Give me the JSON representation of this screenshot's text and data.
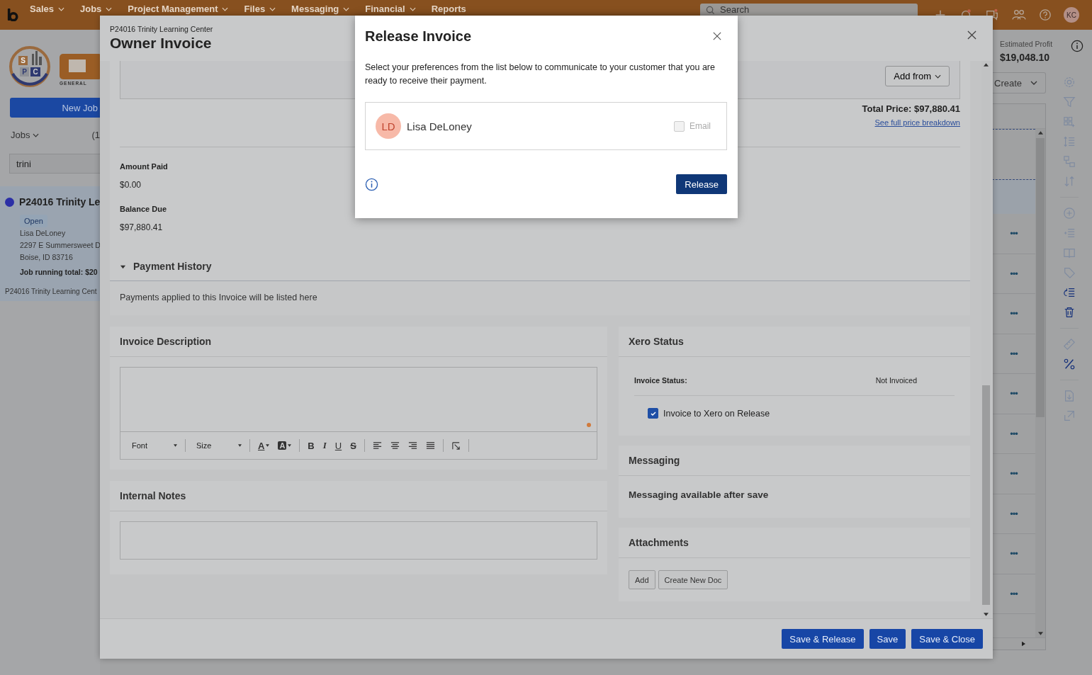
{
  "topbar": {
    "nav": [
      {
        "label": "Sales",
        "dropdown": true
      },
      {
        "label": "Jobs",
        "dropdown": true
      },
      {
        "label": "Project Management",
        "dropdown": true
      },
      {
        "label": "Files",
        "dropdown": true
      },
      {
        "label": "Messaging",
        "dropdown": true
      },
      {
        "label": "Financial",
        "dropdown": true
      },
      {
        "label": "Reports",
        "dropdown": false
      }
    ],
    "search": {
      "placeholder": "Search"
    },
    "avatar": "KC"
  },
  "sidebar": {
    "logo": {
      "letters": [
        "S",
        "P",
        "C"
      ],
      "caption": "GENERAL"
    },
    "new_job": "New Job",
    "jobs_filter": "Jobs",
    "count": "(1",
    "search": {
      "value": "trini"
    },
    "job": {
      "title": "P24016 Trinity Le",
      "color": "#2b2fa6",
      "status": "Open",
      "contact": [
        "Lisa DeLoney",
        "2297 E Summersweet D",
        "Boise, ID 83716"
      ],
      "total": "Job running total: $20",
      "selected": true
    },
    "footer": "P24016 Trinity Learning Cent"
  },
  "job_summary": {
    "profit_label": "Estimated Profit",
    "profit": "$19,048.10",
    "create": "Create",
    "row_menus": [
      "•••",
      "•••",
      "•••",
      "•••",
      "•••",
      "•••",
      "•••",
      "•••",
      "•••",
      "•••"
    ],
    "tools": [
      {
        "kind": "settings",
        "enabled": false
      },
      {
        "kind": "filter",
        "enabled": false
      },
      {
        "kind": "grid",
        "enabled": false
      },
      {
        "kind": "line-height",
        "enabled": false
      },
      {
        "kind": "blocks",
        "enabled": false
      },
      {
        "kind": "sort",
        "enabled": false
      },
      {
        "kind": "separator"
      },
      {
        "kind": "add",
        "enabled": false
      },
      {
        "kind": "list-add",
        "enabled": false
      },
      {
        "kind": "book",
        "enabled": false
      },
      {
        "kind": "tag",
        "enabled": false
      },
      {
        "kind": "list-redo",
        "enabled": true
      },
      {
        "kind": "trash",
        "enabled": true
      },
      {
        "kind": "separator"
      },
      {
        "kind": "ruler",
        "enabled": false
      },
      {
        "kind": "percent",
        "enabled": true
      },
      {
        "kind": "separator"
      },
      {
        "kind": "file",
        "enabled": false
      },
      {
        "kind": "export",
        "enabled": false
      }
    ]
  },
  "invoice": {
    "job": "P24016 Trinity Learning Center",
    "title": "Owner Invoice",
    "add_from": "Add from",
    "total_price": "Total Price: $97,880.41",
    "breakdown_link": "See full price breakdown",
    "amount_paid": {
      "label": "Amount Paid",
      "value": "$0.00"
    },
    "balance_due": {
      "label": "Balance Due",
      "value": "$97,880.41"
    },
    "payment_history": {
      "title": "Payment History",
      "expanded": true,
      "empty_text": "Payments applied to this Invoice will be listed here"
    },
    "description": {
      "title": "Invoice Description",
      "toolbar": [
        {
          "kind": "dropdown",
          "label": "Font"
        },
        {
          "kind": "separator"
        },
        {
          "kind": "dropdown",
          "label": "Size"
        },
        {
          "kind": "separator"
        },
        {
          "kind": "text-color",
          "label": "A"
        },
        {
          "kind": "highlight",
          "label": "A"
        },
        {
          "kind": "separator"
        },
        {
          "kind": "bold",
          "label": "B"
        },
        {
          "kind": "italic",
          "label": "I"
        },
        {
          "kind": "underline",
          "label": "U"
        },
        {
          "kind": "strike",
          "label": "S"
        },
        {
          "kind": "separator"
        },
        {
          "kind": "align-left"
        },
        {
          "kind": "align-center"
        },
        {
          "kind": "align-right"
        },
        {
          "kind": "justify"
        },
        {
          "kind": "separator"
        },
        {
          "kind": "clear-format"
        },
        {
          "kind": "separator"
        }
      ]
    },
    "internal_notes": {
      "title": "Internal Notes"
    },
    "xero": {
      "title": "Xero Status",
      "status_label": "Invoice Status:",
      "status_value": "Not Invoiced",
      "invoice_on_release": {
        "label": "Invoice to Xero on Release",
        "checked": true
      }
    },
    "messaging": {
      "title": "Messaging",
      "text": "Messaging available after save"
    },
    "attachments": {
      "title": "Attachments",
      "buttons": [
        "Add",
        "Create New Doc"
      ]
    },
    "footer_buttons": [
      "Save & Release",
      "Save",
      "Save & Close"
    ]
  },
  "dialog": {
    "title": "Release Invoice",
    "text": "Select your preferences from the list below to communicate to your customer that you are ready to receive their payment.",
    "recipients": [
      {
        "initials": "LD",
        "name": "Lisa DeLoney",
        "email": {
          "label": "Email",
          "checked": false,
          "disabled": true
        }
      }
    ],
    "release": "Release"
  }
}
